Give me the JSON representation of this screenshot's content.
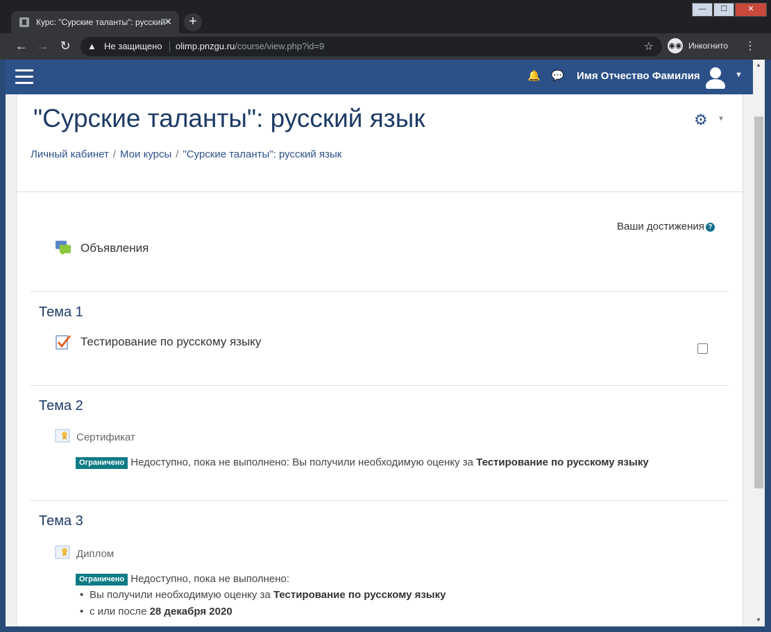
{
  "browser": {
    "tab_title": "Курс: \"Сурские таланты\": русский язык",
    "tab_close": "✕",
    "new_tab": "+",
    "security_label": "Не защищено",
    "url_domain": "olimp.pnzgu.ru",
    "url_path": "/course/view.php?id=9",
    "incognito_label": "Инкогнито",
    "window_buttons": {
      "minimize": "—",
      "maximize": "☐",
      "close": "✕"
    }
  },
  "navbar": {
    "user_name": "Имя Отчество Фамилия"
  },
  "course": {
    "title": "\"Сурские таланты\": русский язык",
    "breadcrumb": [
      "Личный кабинет",
      "Мои курсы",
      "\"Сурские таланты\": русский язык"
    ],
    "achievements_label": "Ваши достижения",
    "announcements": "Объявления"
  },
  "sections": [
    {
      "title": "Тема 1",
      "activity": "Тестирование по русскому языку"
    },
    {
      "title": "Тема 2",
      "activity": "Сертификат",
      "badge": "Ограничено",
      "restriction_text": "Недоступно, пока не выполнено: Вы получили необходимую оценку за",
      "restriction_bold": "Тестирование по русскому языку"
    },
    {
      "title": "Тема 3",
      "activity": "Диплом",
      "badge": "Ограничено",
      "restriction_text": "Недоступно, пока не выполнено:",
      "conditions": [
        {
          "text": "Вы получили необходимую оценку за",
          "bold": "Тестирование по русскому языку"
        },
        {
          "text": "с или после",
          "bold": "28 декабря 2020"
        }
      ]
    }
  ],
  "colors": {
    "navbar": "#2c5189",
    "title": "#1d3b66",
    "badge": "#0f7b85"
  }
}
